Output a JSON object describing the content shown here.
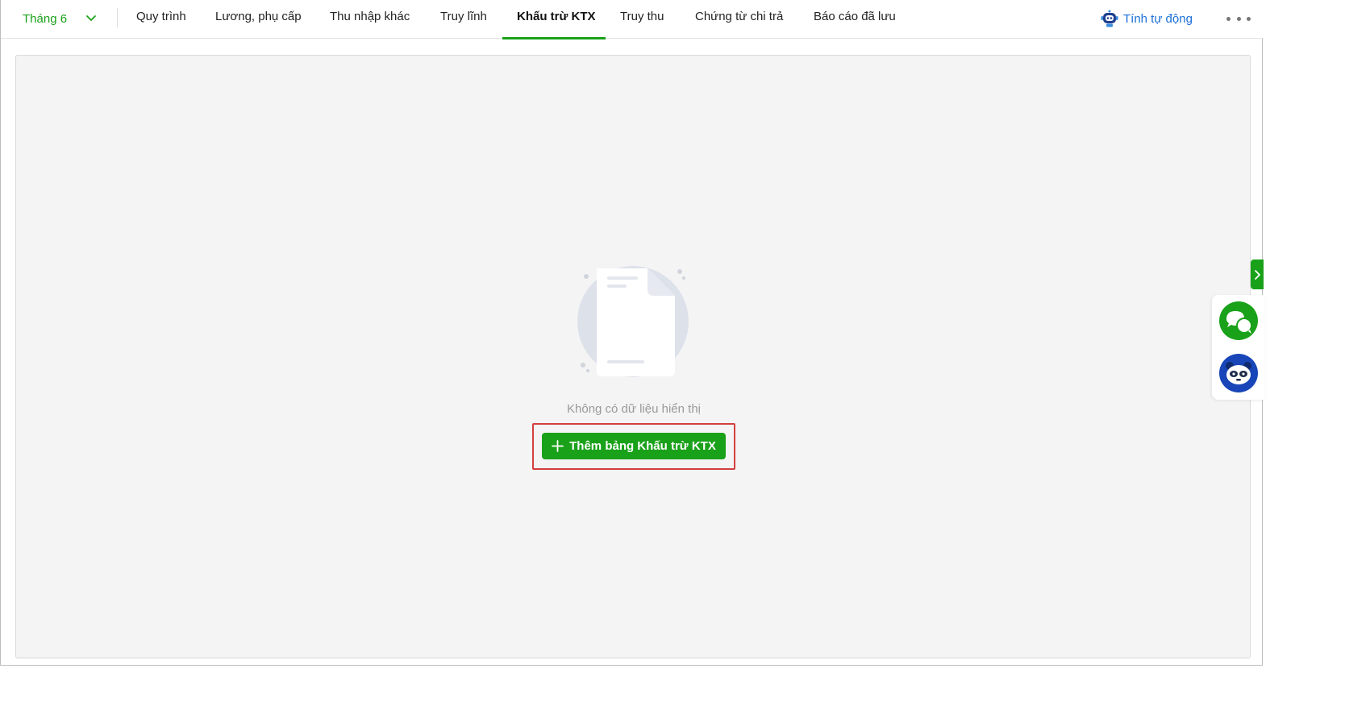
{
  "topbar": {
    "month_label": "Tháng 6",
    "tabs": [
      {
        "label": "Quy trình"
      },
      {
        "label": "Lương, phụ cấp"
      },
      {
        "label": "Thu nhập khác"
      },
      {
        "label": "Truy lĩnh"
      },
      {
        "label": "Khấu trừ KTX",
        "active": true
      },
      {
        "label": "Truy thu"
      },
      {
        "label": "Chứng từ chi trả"
      },
      {
        "label": "Báo cáo đã lưu"
      }
    ],
    "auto_calc_label": "Tính tự động"
  },
  "empty_state": {
    "message": "Không có dữ liệu hiển thị",
    "add_button_label": "Thêm bảng Khấu trừ KTX"
  },
  "colors": {
    "accent_green": "#1aa11a",
    "link_blue": "#1b6fd6",
    "highlight_red": "#d43f3f"
  },
  "icons": {
    "month_dropdown": "chevron-down-icon",
    "auto_calc": "robot-icon",
    "more": "more-horizontal-icon",
    "add": "plus-icon",
    "side_toggle": "chevron-right-icon",
    "chat": "chat-icon",
    "assistant": "panda-bot-icon"
  }
}
